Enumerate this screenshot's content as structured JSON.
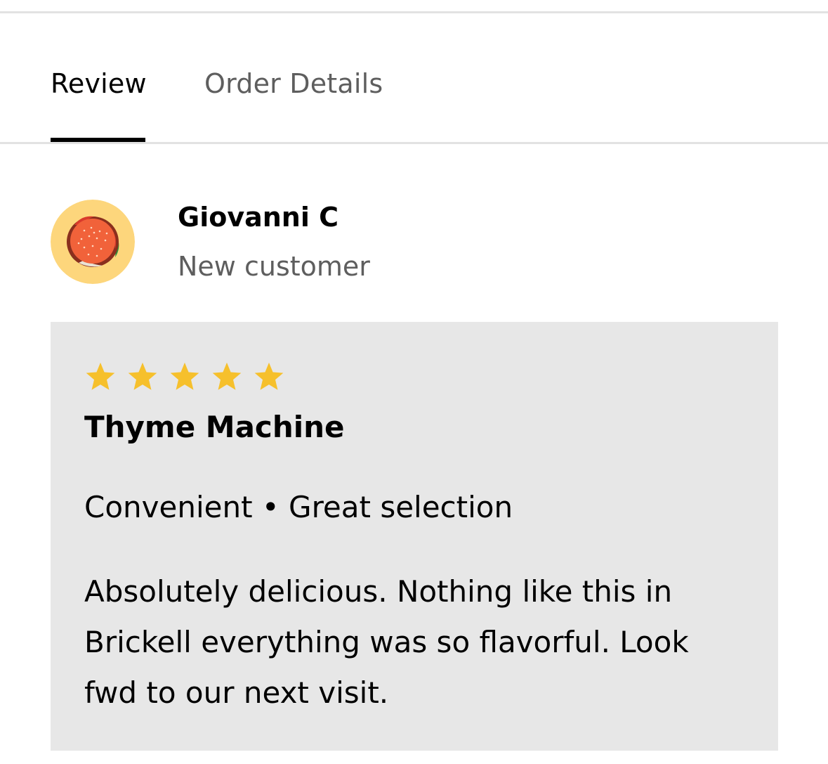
{
  "tabs": [
    {
      "label": "Review",
      "active": true
    },
    {
      "label": "Order Details",
      "active": false
    }
  ],
  "reviewer": {
    "name": "Giovanni C",
    "status": "New customer",
    "avatar_icon": "burger-icon"
  },
  "review": {
    "rating": 5,
    "max_rating": 5,
    "restaurant": "Thyme Machine",
    "tags": "Convenient • Great selection",
    "text": "Absolutely delicious. Nothing like this in Brickell everything was so flavorful. Look fwd to our next visit."
  },
  "colors": {
    "star": "#f6c02c",
    "card_background": "#e7e7e7",
    "avatar_background": "#fdd67c",
    "active_tab_text": "#000000",
    "inactive_tab_text": "#5e5e5e",
    "tab_indicator": "#000000"
  }
}
